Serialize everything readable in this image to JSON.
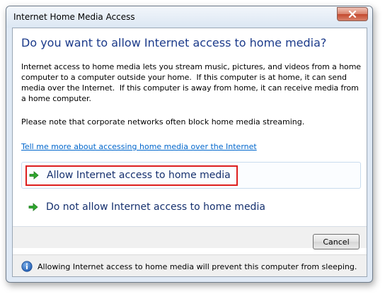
{
  "window": {
    "title": "Internet Home Media Access"
  },
  "content": {
    "heading": "Do you want to allow Internet access to home media?",
    "description": "Internet access to home media lets you stream music, pictures, and videos from a home computer to a computer outside your home.  If this computer is at home, it can send media over the Internet.  If this computer is away from home, it can receive media from a home computer.",
    "note": "Please note that corporate networks often block home media streaming.",
    "help_link": "Tell me more about accessing home media over the Internet",
    "options": [
      {
        "label": "Allow Internet access to home media",
        "icon": "green-arrow-icon"
      },
      {
        "label": "Do not allow Internet access to home media",
        "icon": "green-arrow-icon"
      }
    ]
  },
  "buttons": {
    "cancel": "Cancel"
  },
  "footer": {
    "icon": "info-icon",
    "text": "Allowing Internet access to home media will prevent this computer from sleeping."
  },
  "colors": {
    "heading": "#1b3a8a",
    "link": "#0066cc",
    "highlight": "#dd1f1f",
    "arrow": "#2ea82e"
  }
}
